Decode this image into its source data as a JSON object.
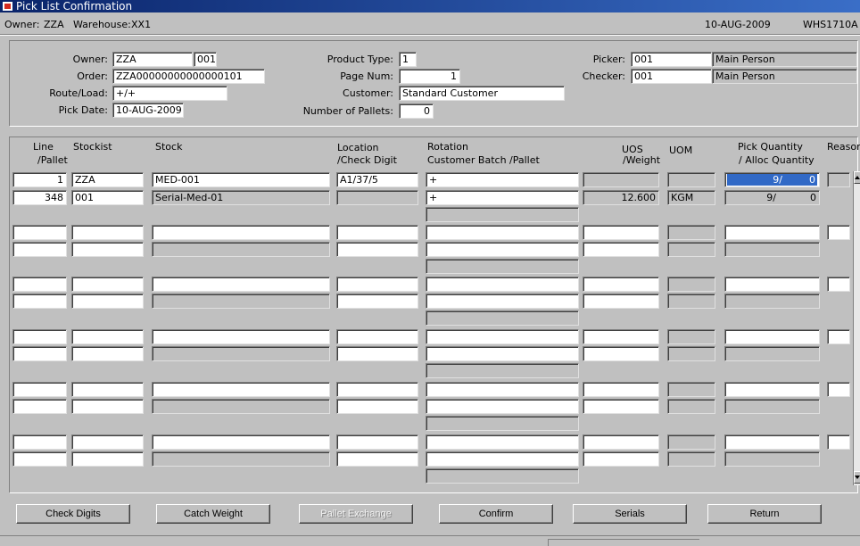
{
  "window": {
    "title": "Pick List Confirmation"
  },
  "infobar": {
    "owner_label": "Owner:",
    "owner_value": "ZZA",
    "warehouse_label": "Warehouse:",
    "warehouse_value": "XX1",
    "date": "10-AUG-2009",
    "screen_code": "WHS1710A"
  },
  "header": {
    "owner_label": "Owner:",
    "owner": "ZZA",
    "owner_code": "001",
    "order_label": "Order:",
    "order": "ZZA00000000000000101",
    "route_label": "Route/Load:",
    "route": "+/+",
    "pick_date_label": "Pick Date:",
    "pick_date": "10-AUG-2009",
    "product_type_label": "Product Type:",
    "product_type": "1",
    "page_num_label": "Page Num:",
    "page_num": "1",
    "customer_label": "Customer:",
    "customer": "Standard Customer",
    "pallets_label": "Number of Pallets:",
    "pallets": "0",
    "picker_label": "Picker:",
    "picker_code": "001",
    "picker_name": "Main Person",
    "checker_label": "Checker:",
    "checker_code": "001",
    "checker_name": "Main Person"
  },
  "grid": {
    "columns": {
      "line": "Line",
      "pallet": "/Pallet",
      "stockist": "Stockist",
      "stock": "Stock",
      "location": "Location",
      "check_digit": "/Check Digit",
      "rotation": "Rotation",
      "customer_batch": "Customer Batch /Pallet",
      "uos": "UOS",
      "weight": "/Weight",
      "uom": "UOM",
      "pick_qty": "Pick Quantity",
      "alloc_qty": "/ Alloc Quantity",
      "reason": "Reason"
    },
    "records": [
      {
        "line": "1",
        "stockist": "ZZA",
        "stock": "MED-001",
        "location": "A1/37/5",
        "rotation": "+",
        "uos": "",
        "uom": "",
        "pick": "9/",
        "alloc": "0",
        "pallet": "348",
        "stockist2": "001",
        "stock2": "Serial-Med-01",
        "check_digit": "",
        "batch": "+",
        "weight": "12.600",
        "uom2": "KGM",
        "pick2": "9/",
        "alloc2": "0"
      }
    ]
  },
  "buttons": {
    "check_digits": "Check Digits",
    "catch_weight": "Catch Weight",
    "pallet_exchange": "Pallet Exchange",
    "confirm": "Confirm",
    "serials": "Serials",
    "return": "Return"
  }
}
